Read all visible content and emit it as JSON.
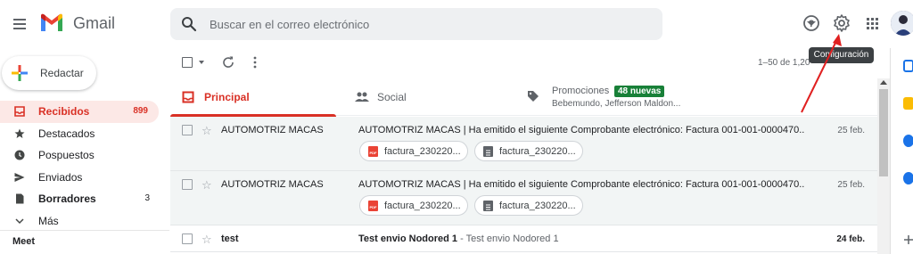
{
  "header": {
    "app_name": "Gmail",
    "search_placeholder": "Buscar en el correo electrónico",
    "tooltip": "Configuración",
    "icons": [
      "menu-icon",
      "gmail-logo",
      "search-icon",
      "caret-down-icon",
      "help-icon",
      "gear-icon",
      "apps-grid-icon",
      "avatar"
    ]
  },
  "sidebar": {
    "compose_label": "Redactar",
    "items": [
      {
        "label": "Recibidos",
        "count": "899",
        "icon": "inbox-icon"
      },
      {
        "label": "Destacados",
        "count": "",
        "icon": "star-icon"
      },
      {
        "label": "Pospuestos",
        "count": "",
        "icon": "clock-icon"
      },
      {
        "label": "Enviados",
        "count": "",
        "icon": "send-icon"
      },
      {
        "label": "Borradores",
        "count": "3",
        "icon": "draft-icon"
      },
      {
        "label": "Más",
        "count": "",
        "icon": "chevron-down-icon"
      }
    ],
    "meet_label": "Meet"
  },
  "toolbar": {
    "pager": "1–50 de 1,20"
  },
  "tabs": [
    {
      "label": "Principal",
      "icon": "inbox-tab-icon"
    },
    {
      "label": "Social",
      "icon": "people-icon"
    },
    {
      "label": "Promociones",
      "badge": "48 nuevas",
      "sub": "Bebemundo, Jefferson Maldon...",
      "icon": "tag-icon"
    }
  ],
  "emails": [
    {
      "sender": "AUTOMOTRIZ MACAS",
      "subject": "AUTOMOTRIZ MACAS | Ha emitido el siguiente Comprobante electrónico: Factura 001-001-0000470...",
      "snippet": "",
      "date": "25 feb.",
      "attachments": [
        "factura_230220...",
        "factura_230220..."
      ],
      "unread": false
    },
    {
      "sender": "AUTOMOTRIZ MACAS",
      "subject": "AUTOMOTRIZ MACAS | Ha emitido el siguiente Comprobante electrónico: Factura 001-001-0000470...",
      "snippet": "",
      "date": "25 feb.",
      "attachments": [
        "factura_230220...",
        "factura_230220..."
      ],
      "unread": false
    },
    {
      "sender": "test",
      "subject": "Test envio Nodored 1",
      "snippet": " - Test envio Nodored 1",
      "date": "24 feb.",
      "attachments": [],
      "unread": true
    }
  ],
  "colors": {
    "accent_red": "#d93025",
    "badge_green": "#188038",
    "active_bg": "#fce8e6",
    "annotation_arrow": "#e02020"
  }
}
